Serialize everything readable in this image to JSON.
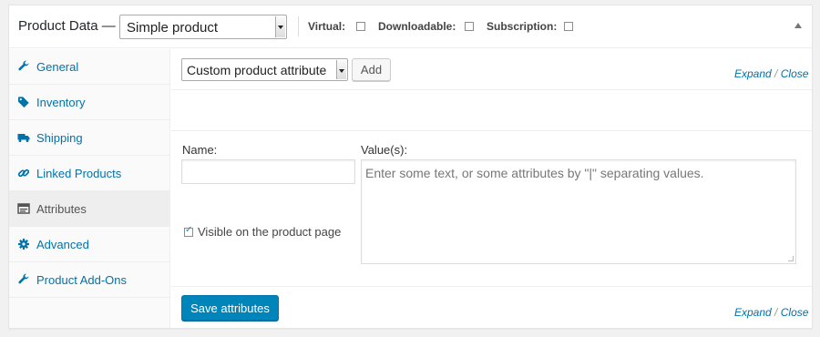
{
  "header": {
    "title": "Product Data —",
    "product_type": "Simple product",
    "options": [
      {
        "label": "Virtual:",
        "checked": false
      },
      {
        "label": "Downloadable:",
        "checked": false
      },
      {
        "label": "Subscription:",
        "checked": false
      }
    ]
  },
  "tabs": [
    {
      "label": "General",
      "icon": "wrench-icon",
      "active": false
    },
    {
      "label": "Inventory",
      "icon": "tag-icon",
      "active": false
    },
    {
      "label": "Shipping",
      "icon": "truck-icon",
      "active": false
    },
    {
      "label": "Linked Products",
      "icon": "link-icon",
      "active": false
    },
    {
      "label": "Attributes",
      "icon": "list-icon",
      "active": true
    },
    {
      "label": "Advanced",
      "icon": "gear-icon",
      "active": false
    },
    {
      "label": "Product Add-Ons",
      "icon": "wrench-icon",
      "active": false
    }
  ],
  "toolbar": {
    "attribute_select": "Custom product attribute",
    "add_label": "Add",
    "expand": "Expand",
    "separator": "/",
    "close": "Close"
  },
  "attribute": {
    "name_label": "Name:",
    "name_value": "",
    "values_label": "Value(s):",
    "values_placeholder": "Enter some text, or some attributes by \"|\" separating values.",
    "visible_label": "Visible on the product page",
    "visible_checked": true
  },
  "footer": {
    "save_label": "Save attributes",
    "expand": "Expand",
    "separator": "/",
    "close": "Close"
  },
  "colors": {
    "link": "#0073aa",
    "primary_button": "#0085ba"
  }
}
